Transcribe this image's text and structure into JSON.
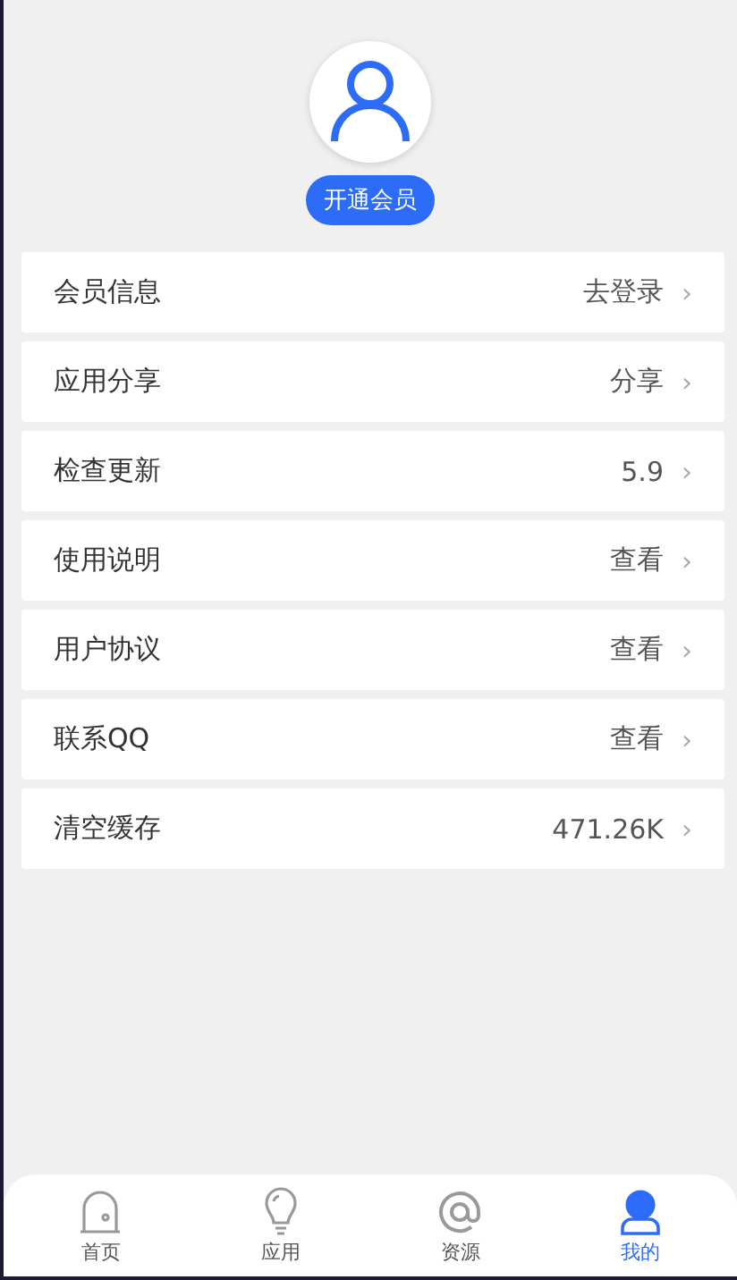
{
  "profile": {
    "badge": "开通会员"
  },
  "menu": [
    {
      "label": "会员信息",
      "value": "去登录",
      "arrow": "›"
    },
    {
      "label": "应用分享",
      "value": "分享",
      "arrow": "›"
    },
    {
      "label": "检查更新",
      "value": "5.9",
      "arrow": "›"
    },
    {
      "label": "使用说明",
      "value": "查看",
      "arrow": "›"
    },
    {
      "label": "用户协议",
      "value": "查看",
      "arrow": "›"
    },
    {
      "label": "联系QQ",
      "value": "查看",
      "arrow": "›"
    },
    {
      "label": "清空缓存",
      "value": "471.26K",
      "arrow": "›"
    }
  ],
  "tabs": [
    {
      "label": "首页",
      "kind": "home",
      "selected": false
    },
    {
      "label": "应用",
      "kind": "bulb",
      "selected": false
    },
    {
      "label": "资源",
      "kind": "at",
      "selected": false
    },
    {
      "label": "我的",
      "kind": "user",
      "selected": true
    }
  ]
}
